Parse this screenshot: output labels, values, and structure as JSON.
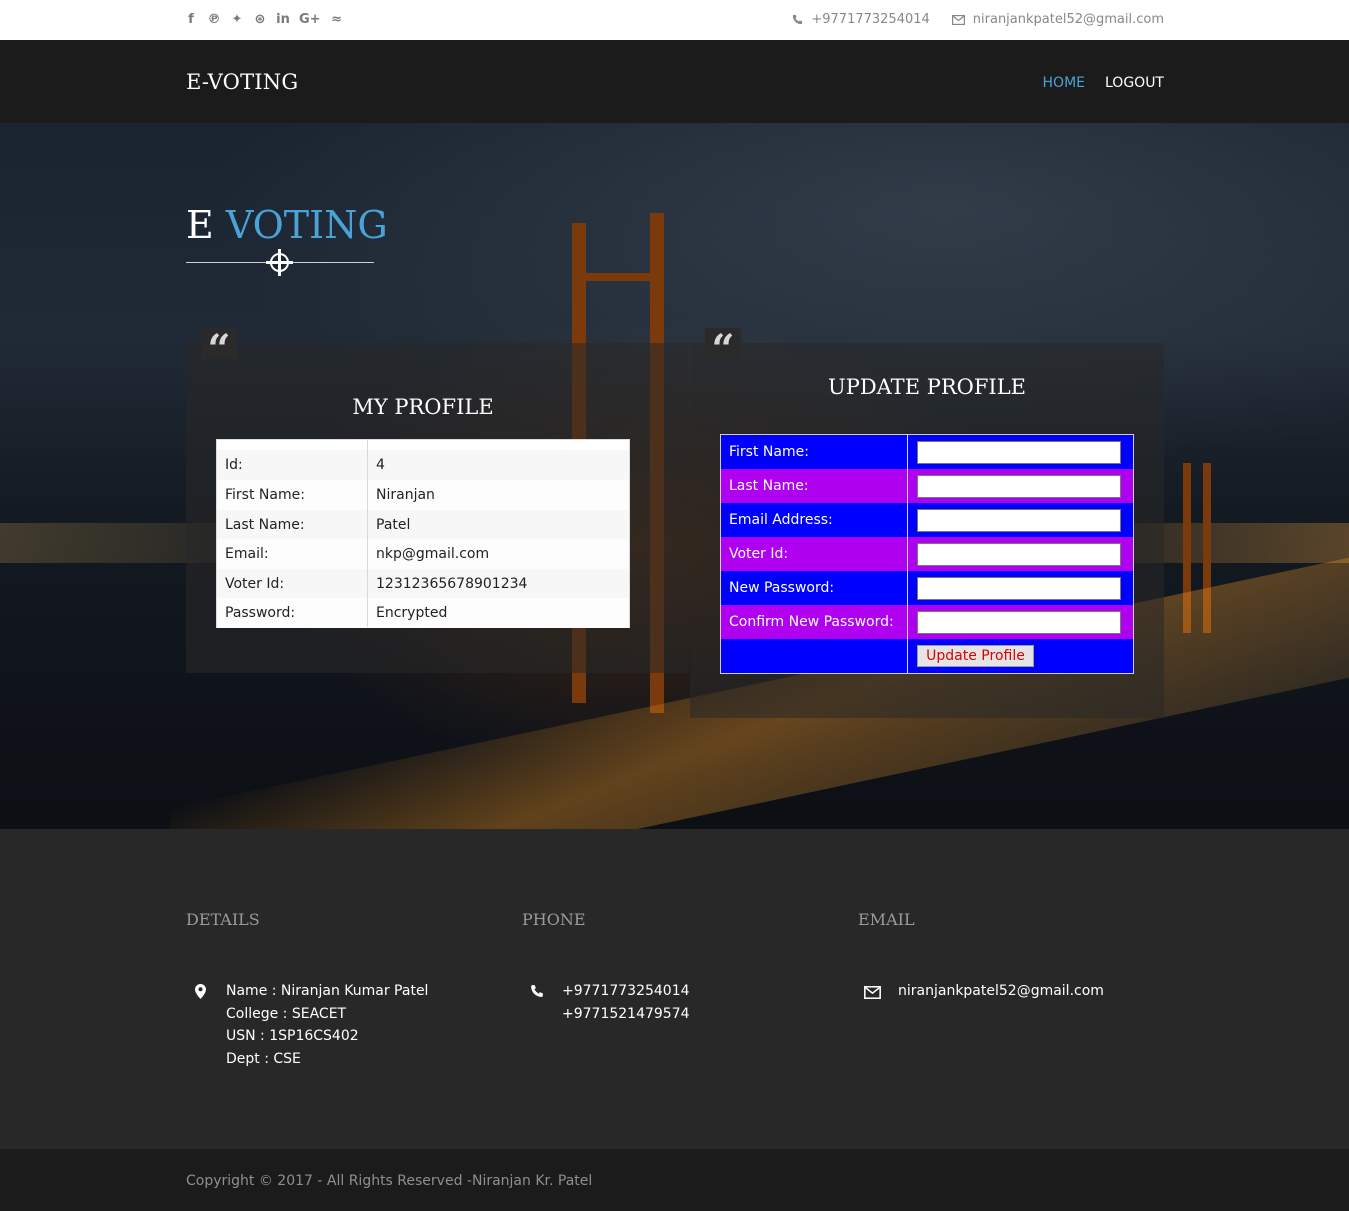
{
  "topbar": {
    "social": [
      {
        "icon": "facebook-icon",
        "glyph": "f"
      },
      {
        "icon": "pinterest-icon",
        "glyph": "℗"
      },
      {
        "icon": "twitter-icon",
        "glyph": "✦"
      },
      {
        "icon": "dribbble-icon",
        "glyph": "⊛"
      },
      {
        "icon": "linkedin-icon",
        "glyph": "in"
      },
      {
        "icon": "google-plus-icon",
        "glyph": "G+"
      },
      {
        "icon": "rss-icon",
        "glyph": "≈"
      }
    ],
    "phone": "+9771773254014",
    "email": "niranjankpatel52@gmail.com"
  },
  "nav": {
    "brand": "E-VOTING",
    "home": "HOME",
    "logout": "LOGOUT",
    "active_color": "#4aa3d6"
  },
  "hero": {
    "title_part1": "E",
    "title_part2": "VOTING"
  },
  "profile": {
    "title": "MY PROFILE",
    "rows": [
      {
        "label": "Id:",
        "value": "4"
      },
      {
        "label": "First Name:",
        "value": "Niranjan"
      },
      {
        "label": "Last Name:",
        "value": "Patel"
      },
      {
        "label": "Email:",
        "value": "nkp@gmail.com"
      },
      {
        "label": "Voter Id:",
        "value": "12312365678901234"
      },
      {
        "label": "Password:",
        "value": "Encrypted"
      }
    ]
  },
  "update": {
    "title": "UPDATE PROFILE",
    "fields": [
      {
        "label": "First Name:",
        "value": ""
      },
      {
        "label": "Last Name:",
        "value": ""
      },
      {
        "label": "Email Address:",
        "value": ""
      },
      {
        "label": "Voter Id:",
        "value": ""
      },
      {
        "label": "New Password:",
        "value": ""
      },
      {
        "label": "Confirm New Password:",
        "value": ""
      }
    ],
    "button": "Update Profile",
    "row_colors": [
      "#0000ff",
      "#b000f0"
    ]
  },
  "footer": {
    "details_heading": "DETAILS",
    "phone_heading": "PHONE",
    "email_heading": "EMAIL",
    "details": [
      "Name : Niranjan Kumar Patel",
      "College : SEACET",
      "USN : 1SP16CS402",
      "Dept : CSE"
    ],
    "phones": [
      "+9771773254014",
      "+9771521479574"
    ],
    "email": "niranjankpatel52@gmail.com",
    "copyright": "Copyright © 2017 - All Rights Reserved -Niranjan Kr. Patel"
  }
}
